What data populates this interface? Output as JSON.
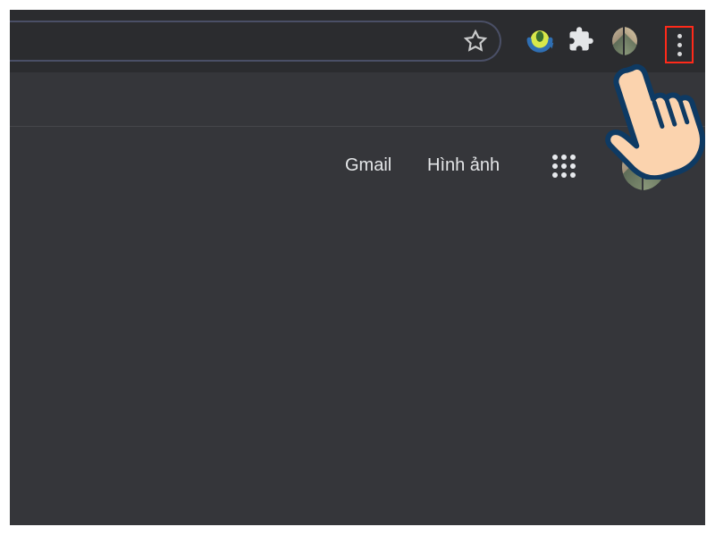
{
  "toolbar": {
    "omnibox": {
      "placeholder": ""
    },
    "star_icon": "star-outline",
    "idm_icon": "idm-icon",
    "extensions_icon": "puzzle-icon",
    "profile_icon": "avatar-pair",
    "menu_icon": "kebab-menu",
    "menu_highlight_color": "#ff2a1a"
  },
  "google_navbar": {
    "gmail": "Gmail",
    "images": "Hình ảnh",
    "apps_icon": "apps-grid",
    "avatar": "avatar-pair"
  },
  "annotation": {
    "cursor": "pointing-hand"
  }
}
